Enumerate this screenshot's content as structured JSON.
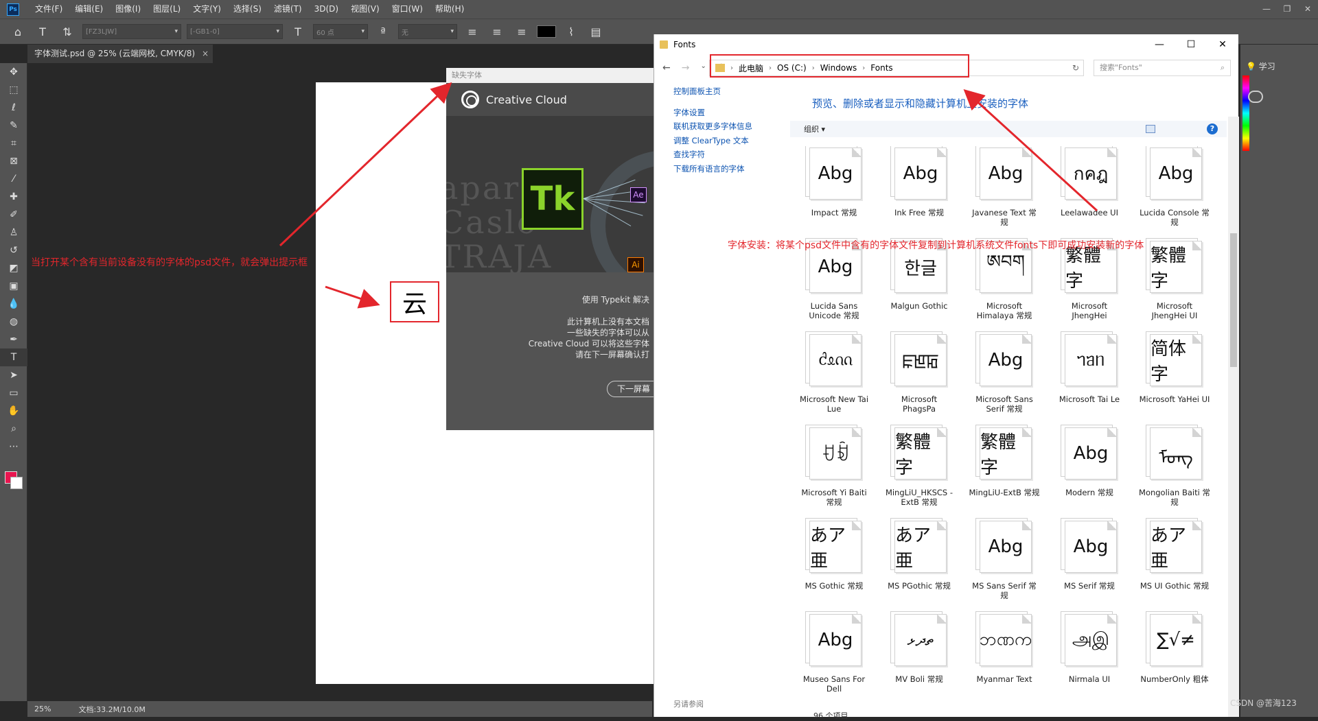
{
  "photoshop": {
    "menu": [
      "文件(F)",
      "编辑(E)",
      "图像(I)",
      "图层(L)",
      "文字(Y)",
      "选择(S)",
      "滤镜(T)",
      "3D(D)",
      "视图(V)",
      "窗口(W)",
      "帮助(H)"
    ],
    "options": {
      "font_family": "[FZ3LJW]",
      "font_style": "[-GB1-0]",
      "font_size": "60 点",
      "aa_mode": "无"
    },
    "doc_tab": "字体测试.psd @ 25% (云端网校, CMYK/8)",
    "doc_tab_close": "×",
    "status_zoom": "25%",
    "status_doc": "文档:33.2M/10.0M",
    "right_panel_learn": "学习",
    "fg_color": "#e8154f",
    "bg_color": "#ffffff"
  },
  "dialog": {
    "titlebar": "缺失字体",
    "header": "Creative Cloud",
    "badge_ae": "Ae",
    "badge_ai": "Ai",
    "logo_tk": "Tk",
    "hero_text_1": "apar",
    "hero_text_2": "Caslo",
    "hero_text_3": "TRAJA",
    "typekit_line": "使用 Typekit 解决",
    "body_lines": [
      "此计算机上没有本文档",
      "一些缺失的字体可以从",
      "Creative Cloud 可以将这些字体",
      "请在下一屏幕确认打"
    ],
    "next_button": "下一屏幕"
  },
  "explorer": {
    "title": "Fonts",
    "nav": {
      "back": "←",
      "forward": "→",
      "recent": "⌄",
      "up": "↑"
    },
    "breadcrumb": [
      "此电脑",
      "OS (C:)",
      "Windows",
      "Fonts"
    ],
    "search_placeholder": "搜索\"Fonts\"",
    "sidebar": [
      "控制面板主页",
      "字体设置",
      "联机获取更多字体信息",
      "调整 ClearType 文本",
      "查找字符",
      "下载所有语言的字体"
    ],
    "see_also": "另请参阅",
    "heading": "预览、删除或者显示和隐藏计算机上安装的字体",
    "organize": "组织 ▾",
    "help": "?",
    "status": "96 个项目",
    "fonts": [
      {
        "sample": "Abg",
        "name": "Impact 常规"
      },
      {
        "sample": "Abg",
        "name": "Ink Free 常规"
      },
      {
        "sample": "Abg",
        "name": "Javanese Text 常规"
      },
      {
        "sample": "กคฎ",
        "name": "Leelawadee UI"
      },
      {
        "sample": "Abg",
        "name": "Lucida Console 常规"
      },
      {
        "sample": "Abg",
        "name": "Lucida Sans Unicode 常规"
      },
      {
        "sample": "한글",
        "name": "Malgun Gothic"
      },
      {
        "sample": "ཨབག",
        "name": "Microsoft Himalaya 常规"
      },
      {
        "sample": "繁體字",
        "name": "Microsoft JhengHei"
      },
      {
        "sample": "繁體字",
        "name": "Microsoft JhengHei UI"
      },
      {
        "sample": "ᦺᦸᦶ",
        "name": "Microsoft New Tai Lue"
      },
      {
        "sample": "ꡀꡁꡂ",
        "name": "Microsoft PhagsPa"
      },
      {
        "sample": "Abg",
        "name": "Microsoft Sans Serif 常规"
      },
      {
        "sample": "ᥐᥑᥒ",
        "name": "Microsoft Tai Le"
      },
      {
        "sample": "简体字",
        "name": "Microsoft YaHei UI"
      },
      {
        "sample": "ꀀꀁ",
        "name": "Microsoft Yi Baiti 常规"
      },
      {
        "sample": "繁體字",
        "name": "MingLiU_HKSCS -ExtB 常规"
      },
      {
        "sample": "繁體字",
        "name": "MingLiU-ExtB 常规"
      },
      {
        "sample": "Abg",
        "name": "Modern 常规"
      },
      {
        "sample": "ᠮᠤᠩ",
        "name": "Mongolian Baiti 常规"
      },
      {
        "sample": "あア亜",
        "name": "MS Gothic 常规"
      },
      {
        "sample": "あア亜",
        "name": "MS PGothic 常规"
      },
      {
        "sample": "Abg",
        "name": "MS Sans Serif 常规"
      },
      {
        "sample": "Abg",
        "name": "MS Serif 常规"
      },
      {
        "sample": "あア亜",
        "name": "MS UI Gothic 常规"
      },
      {
        "sample": "Abg",
        "name": "Museo Sans For Dell"
      },
      {
        "sample": "ތދޅ",
        "name": "MV Boli 常规"
      },
      {
        "sample": "ဘဏက",
        "name": "Myanmar Text"
      },
      {
        "sample": "அஇ",
        "name": "Nirmala UI"
      },
      {
        "sample": "∑√≠",
        "name": "NumberOnly 粗体"
      }
    ]
  },
  "annotations": {
    "missing_font_note": "当打开某个含有当前设备没有的字体的psd文件，就会弹出提示框",
    "install_note": "字体安装：将某个psd文件中含有的字体文件复制到计算机系统文件fonts下即可成功安装新的字体",
    "font_glyph": "云",
    "accent": "#e3262c"
  },
  "watermark": "CSDN @苦海123"
}
